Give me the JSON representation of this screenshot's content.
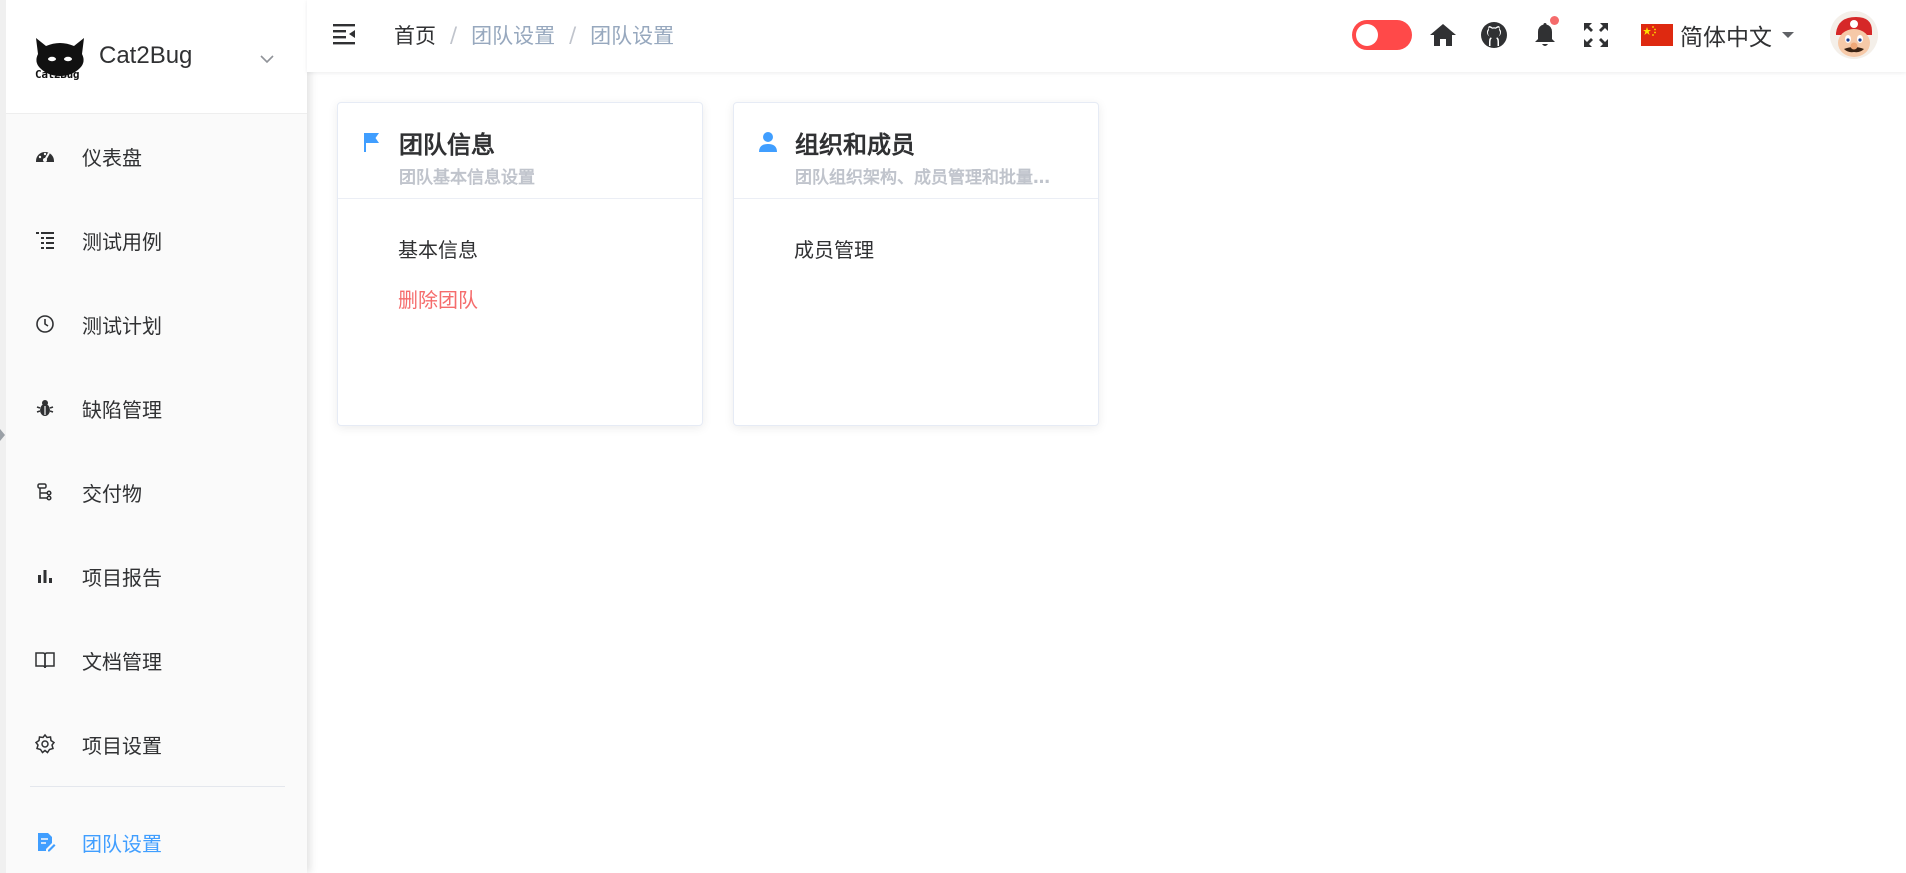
{
  "brand": {
    "name": "Cat2Bug",
    "logo_caption": "Cat2Bug"
  },
  "sidebar": {
    "items": [
      {
        "label": "仪表盘",
        "icon": "dashboard-icon"
      },
      {
        "label": "测试用例",
        "icon": "list-icon"
      },
      {
        "label": "测试计划",
        "icon": "clock-icon"
      },
      {
        "label": "缺陷管理",
        "icon": "bug-icon"
      },
      {
        "label": "交付物",
        "icon": "tree-icon"
      },
      {
        "label": "项目报告",
        "icon": "bar-chart-icon"
      },
      {
        "label": "文档管理",
        "icon": "book-icon"
      },
      {
        "label": "项目设置",
        "icon": "gear-icon"
      }
    ],
    "team_item": {
      "label": "团队设置",
      "icon": "document-edit-icon",
      "active": true
    }
  },
  "header": {
    "breadcrumb": [
      "首页",
      "团队设置",
      "团队设置"
    ],
    "language": "简体中文"
  },
  "cards": [
    {
      "title": "团队信息",
      "subtitle": "团队基本信息设置",
      "icon": "flag-icon",
      "links": [
        {
          "label": "基本信息",
          "danger": false
        },
        {
          "label": "删除团队",
          "danger": true
        }
      ]
    },
    {
      "title": "组织和成员",
      "subtitle": "团队组织架构、成员管理和批量…",
      "icon": "user-icon",
      "links": [
        {
          "label": "成员管理",
          "danger": false
        }
      ]
    }
  ],
  "colors": {
    "accent": "#409eff",
    "danger": "#f56c6c",
    "toggle": "#ff4949",
    "muted": "#97a8be"
  }
}
